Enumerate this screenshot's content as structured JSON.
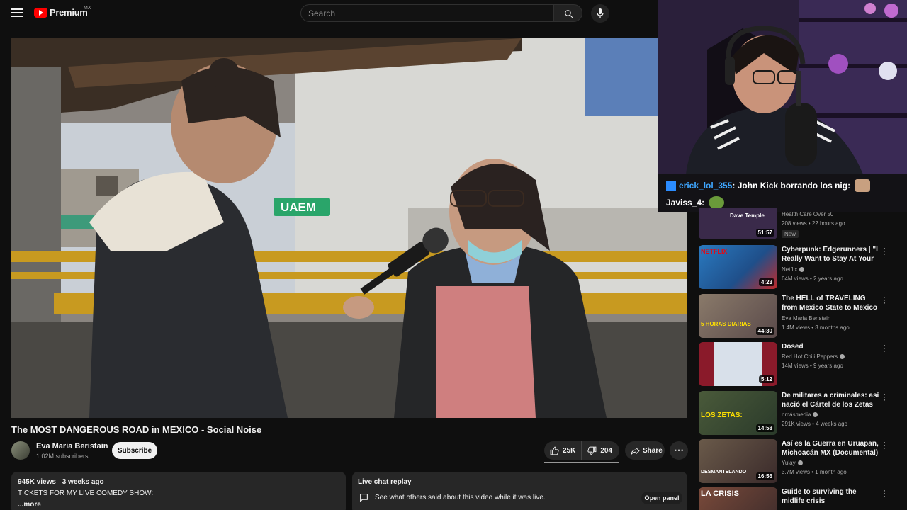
{
  "masthead": {
    "menu_icon": "hamburger-icon",
    "logo_text": "Premium",
    "logo_region": "MX",
    "search_placeholder": "Search",
    "search_icon": "search-icon",
    "mic_icon": "mic-icon"
  },
  "overlay": {
    "chat": [
      {
        "user": "erick_lol_355",
        "message": ": John Kick borrando los nig:"
      },
      {
        "user": "Javiss_4",
        "message": ":"
      }
    ]
  },
  "video": {
    "title": "The MOST DANGEROUS ROAD in MEXICO - Social Noise",
    "sign_text": "UAEM",
    "channel": {
      "name": "Eva Maria Beristain",
      "subscribers": "1.02M subscribers",
      "subscribe_label": "Subscribe"
    },
    "likes": "25K",
    "dislikes": "204",
    "share_label": "Share",
    "more_label": "⋯"
  },
  "description": {
    "views": "945K views",
    "age": "3 weeks ago",
    "text": "TICKETS FOR MY LIVE COMEDY SHOW:",
    "more": "...more"
  },
  "live_chat": {
    "title": "Live chat replay",
    "text": "See what others said about this video while it was live.",
    "open_label": "Open panel"
  },
  "recommendations": [
    {
      "title": "",
      "channel": "Health Care Over 50",
      "views": "208 views • 22 hours ago",
      "badge": "New",
      "duration": "51:57",
      "thumb_text": "Dave Temple",
      "verified": false,
      "color": "#3a2a4a"
    },
    {
      "title": "Cyberpunk: Edgerunners | \"I Really Want to Stay At Your ...",
      "channel": "Netflix",
      "views": "64M views • 2 years ago",
      "duration": "4:23",
      "thumb_text": "NETFLIX",
      "verified": true,
      "color": "#1f5f9a"
    },
    {
      "title": "The HELL of TRAVELING from Mexico State to Mexico City - ...",
      "channel": "Eva Maria Beristain",
      "views": "1.4M views • 3 months ago",
      "duration": "44:30",
      "thumb_text": "5 HORAS DIARIAS",
      "verified": false,
      "color": "#7a6a5a"
    },
    {
      "title": "Dosed",
      "channel": "Red Hot Chili Peppers",
      "views": "14M views • 9 years ago",
      "duration": "5:12",
      "thumb_text": "",
      "verified": true,
      "color": "#8a1a2a"
    },
    {
      "title": "De militares a criminales: así nació el Cártel de los Zetas",
      "channel": "nmásmedia",
      "views": "291K views • 4 weeks ago",
      "duration": "14:58",
      "thumb_text": "LOS ZETAS:",
      "verified": true,
      "color": "#4a5a3a"
    },
    {
      "title": "Así es la Guerra en Uruapan, Michoacán MX (Documental)",
      "channel": "Yulay",
      "views": "3.7M views • 1 month ago",
      "duration": "16:56",
      "thumb_text": "DESMANTELANDO",
      "verified": true,
      "color": "#5a4a3a"
    },
    {
      "title": "Guide to surviving the midlife crisis",
      "channel": "",
      "views": "",
      "duration": "",
      "thumb_text": "LA CRISIS",
      "verified": false,
      "color": "#6a3a2a"
    }
  ]
}
